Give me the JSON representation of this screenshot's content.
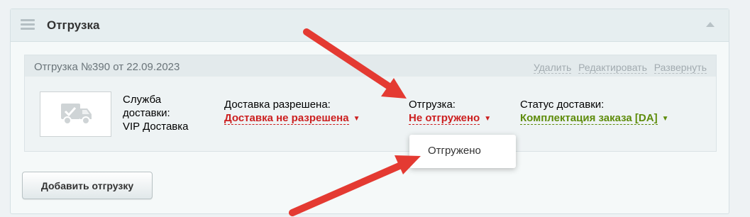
{
  "panel": {
    "title": "Отгрузка"
  },
  "shipment": {
    "title": "Отгрузка №390 от 22.09.2023",
    "links": {
      "delete": "Удалить",
      "edit": "Редактировать",
      "expand": "Развернуть"
    },
    "service": {
      "line1": "Служба",
      "line2": "доставки:",
      "line3": "VIP Доставка"
    },
    "delivery_allowed": {
      "label": "Доставка разрешена:",
      "value": "Доставка не разрешена"
    },
    "shipment_status": {
      "label": "Отгрузка:",
      "value": "Не отгружено"
    },
    "delivery_status": {
      "label": "Статус доставки:",
      "value": "Комплектация заказа [DA]"
    }
  },
  "dropdown": {
    "options": [
      "Отгружено"
    ]
  },
  "buttons": {
    "add_shipment": "Добавить отгрузку"
  },
  "colors": {
    "link_red": "#cc1f1f",
    "link_green": "#5e8c0b",
    "annotation_arrow": "#e43a32"
  },
  "icons": {
    "truck": "truck-icon",
    "drag": "drag-handle-icon",
    "collapse": "collapse-triangle-icon",
    "caret": "caret-down-icon"
  }
}
